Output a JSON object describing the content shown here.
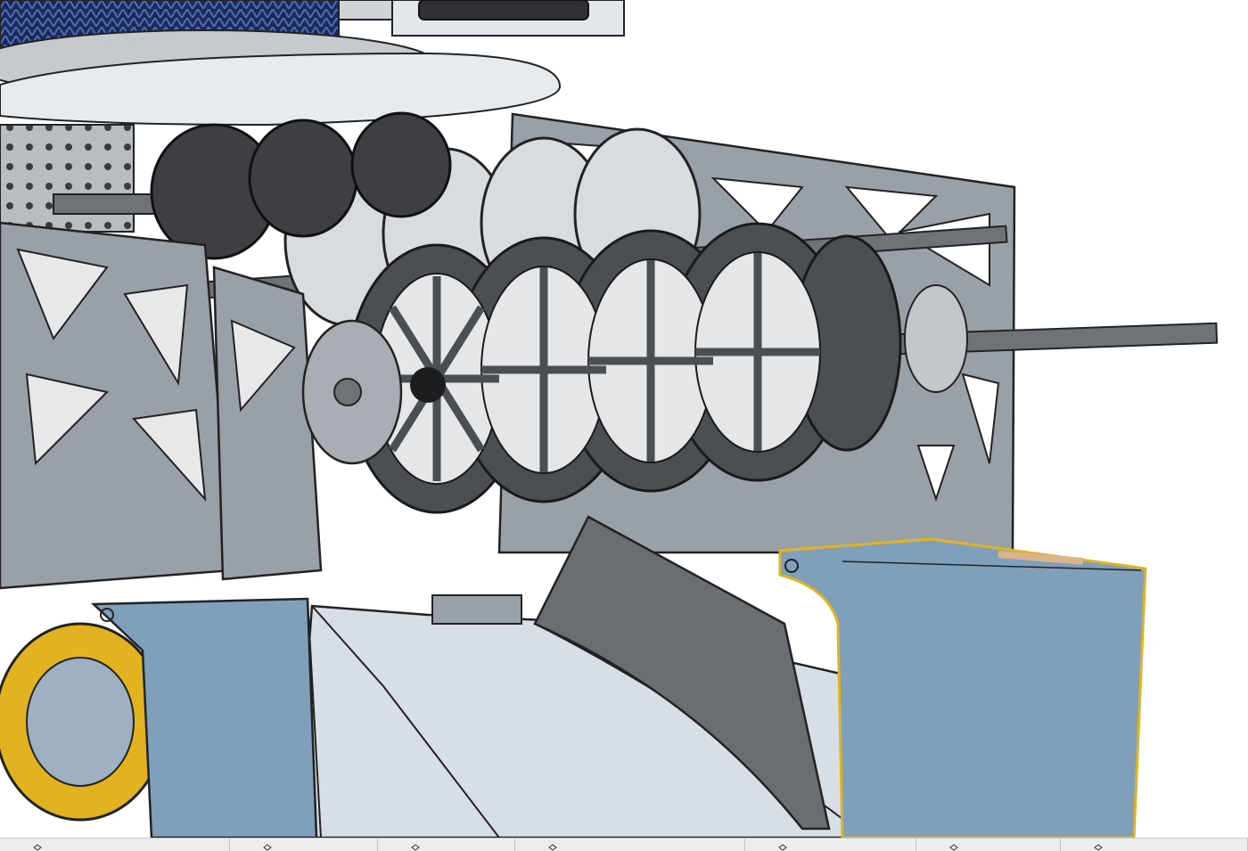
{
  "app": {
    "viewport_label": "",
    "background": "#ffffff"
  },
  "colors": {
    "frame_plate": "#9aa0a7",
    "frame_dark": "#2b2d30",
    "rubber_gray": "#5f6266",
    "light_panel": "#d7dee6",
    "blue_panel": "#7f9fba",
    "yellow_edge": "#e2b320",
    "shaft": "#6f7378"
  },
  "tab_bar": {
    "tabs": [
      {
        "label": "",
        "icon": "part-studio-icon"
      },
      {
        "label": "",
        "icon": "part-studio-icon"
      },
      {
        "label": "",
        "icon": "part-studio-icon"
      },
      {
        "label": "",
        "icon": "part-studio-icon"
      },
      {
        "label": "",
        "icon": "part-studio-icon"
      },
      {
        "label": "",
        "icon": "part-studio-icon"
      },
      {
        "label": "",
        "icon": "part-studio-icon"
      },
      {
        "label": "",
        "icon": "part-studio-icon"
      }
    ]
  }
}
